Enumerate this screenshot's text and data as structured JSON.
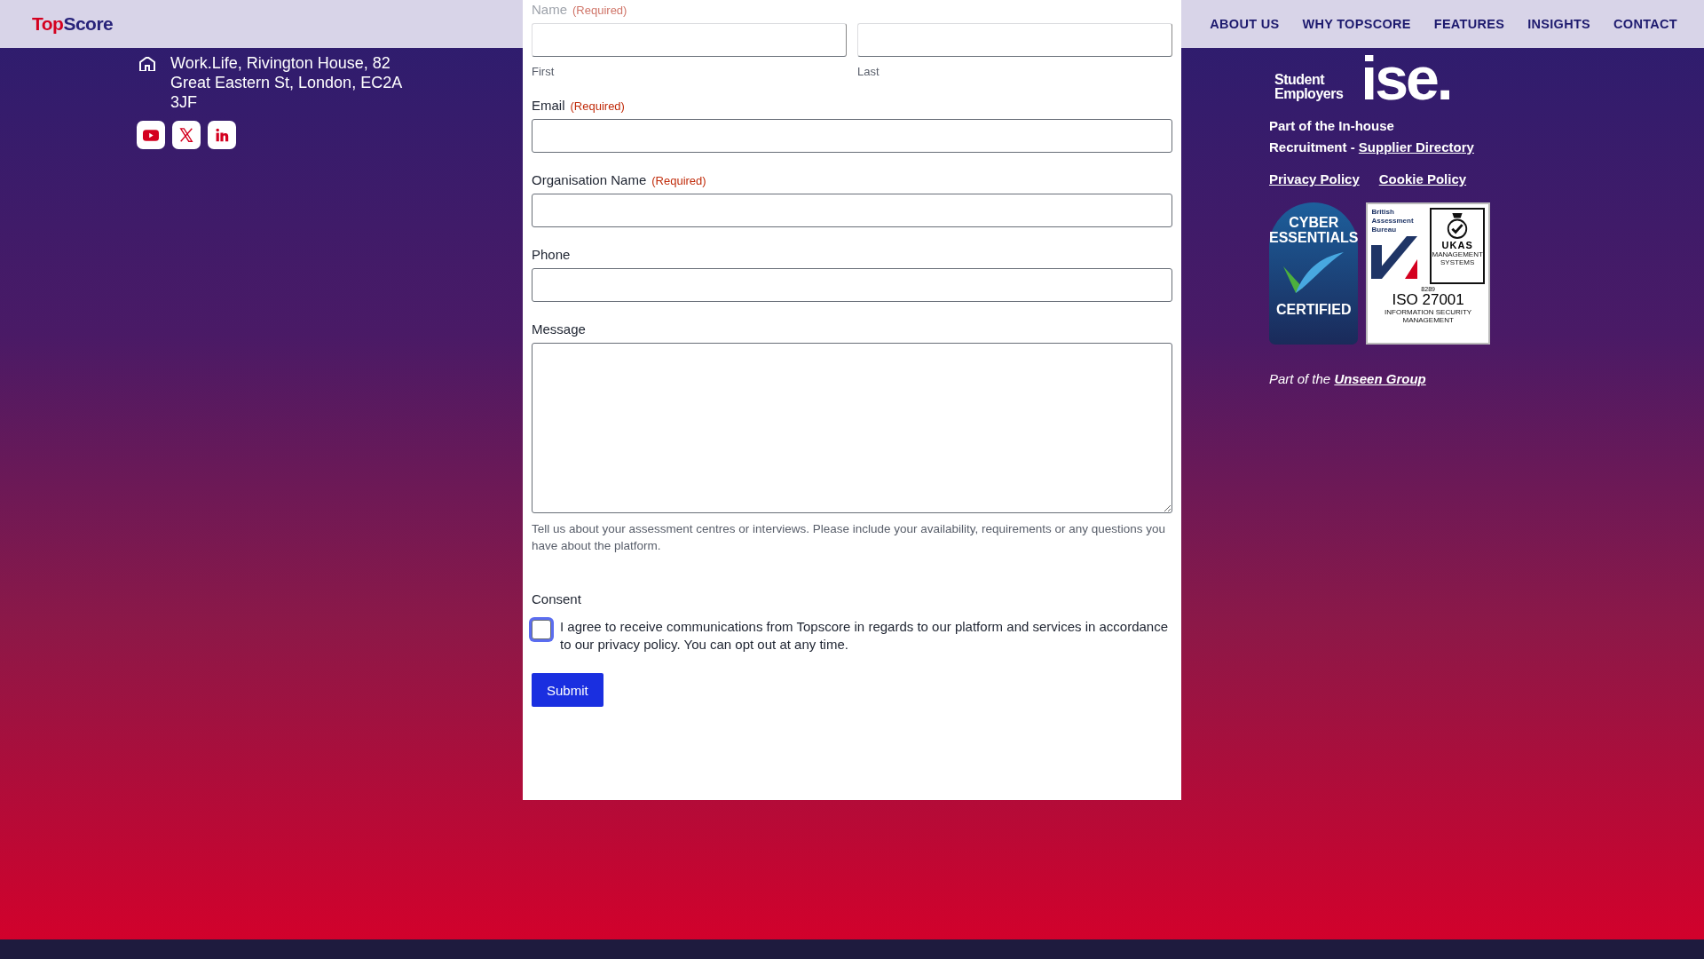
{
  "header": {
    "logo": {
      "part_1": "Top",
      "part_2": "Score"
    },
    "nav": [
      "ABOUT US",
      "WHY TOPSCORE",
      "FEATURES",
      "INSIGHTS",
      "CONTACT"
    ]
  },
  "address": "Work.Life, Rivington House, 82 Great Eastern St, London, EC2A 3JF",
  "form": {
    "fields": [
      {
        "kind": "name",
        "label": "Name",
        "required": "(Required)",
        "dimmed": true,
        "sublabels": [
          "First",
          "Last"
        ]
      },
      {
        "kind": "text",
        "label": "Email",
        "required": "(Required)",
        "dimmed": false
      },
      {
        "kind": "text",
        "label": "Organisation Name",
        "required": "(Required)",
        "dimmed": false
      },
      {
        "kind": "text",
        "label": "Phone",
        "dimmed": false
      },
      {
        "kind": "textarea",
        "label": "Message",
        "dimmed": false,
        "description": "Tell us about your assessment centres or interviews. Please include your availability, requirements or any questions you have about the platform."
      }
    ],
    "consent": {
      "label": "Consent",
      "checked": false,
      "text": "I agree to receive communications from Topscore in regards to our platform and services in accordance to our privacy policy. You can opt out at any time."
    },
    "submit": "Submit"
  },
  "right": {
    "ise_logo": {
      "lines": [
        "Student",
        "Employers"
      ],
      "mark": "ise."
    },
    "recruitment": {
      "text": "Part of the In-house Recruitment - ",
      "link": "Supplier Directory"
    },
    "policies": [
      "Privacy Policy",
      "Cookie Policy"
    ],
    "cyber_badge": {
      "line_1": "CYBER",
      "line_2": "ESSENTIALS",
      "line_3": "CERTIFIED"
    },
    "iso_badge": {
      "org": [
        "British",
        "Assessment",
        "Bureau"
      ],
      "ukas": "UKAS",
      "ukas_sub": [
        "MANAGEMENT",
        "SYSTEMS"
      ],
      "number": "8289",
      "standard": "ISO 27001",
      "subtitle": [
        "INFORMATION SECURITY",
        "MANAGEMENT"
      ]
    },
    "group": {
      "text": "Part of the ",
      "link": "Unseen Group"
    }
  }
}
